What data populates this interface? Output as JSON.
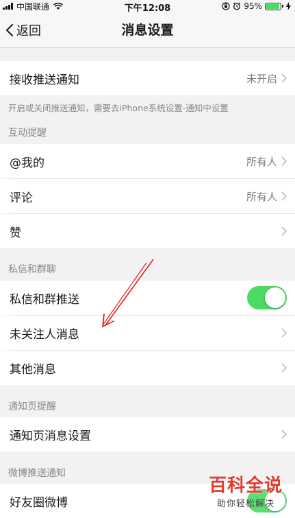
{
  "status_bar": {
    "carrier": "中国联通",
    "time": "下午12:08",
    "battery": "95%",
    "battery_level": 0.95
  },
  "navbar": {
    "back_label": "返回",
    "title": "消息设置"
  },
  "push": {
    "label": "接收推送通知",
    "value": "未开启",
    "hint": "开启或关闭推送通知，需要去iPhone系统设置-通知中设置"
  },
  "interaction": {
    "section": "互动提醒",
    "items": [
      {
        "label": "@我的",
        "value": "所有人"
      },
      {
        "label": "评论",
        "value": "所有人"
      },
      {
        "label": "赞",
        "value": ""
      }
    ]
  },
  "dm": {
    "section": "私信和群聊",
    "push_label": "私信和群推送",
    "push_on": true,
    "items": [
      {
        "label": "未关注人消息"
      },
      {
        "label": "其他消息"
      }
    ]
  },
  "notify_page": {
    "section": "通知页提醒",
    "items": [
      {
        "label": "通知页消息设置"
      }
    ]
  },
  "weibo_push": {
    "section": "微博推送通知",
    "items": [
      {
        "label": "好友圈微博"
      }
    ]
  },
  "watermark": {
    "title": "百科全说",
    "subtitle": "助你轻松解决"
  },
  "colors": {
    "toggle_on": "#4cd964",
    "arrow": "#e02020",
    "watermark": "#e03b2b"
  }
}
